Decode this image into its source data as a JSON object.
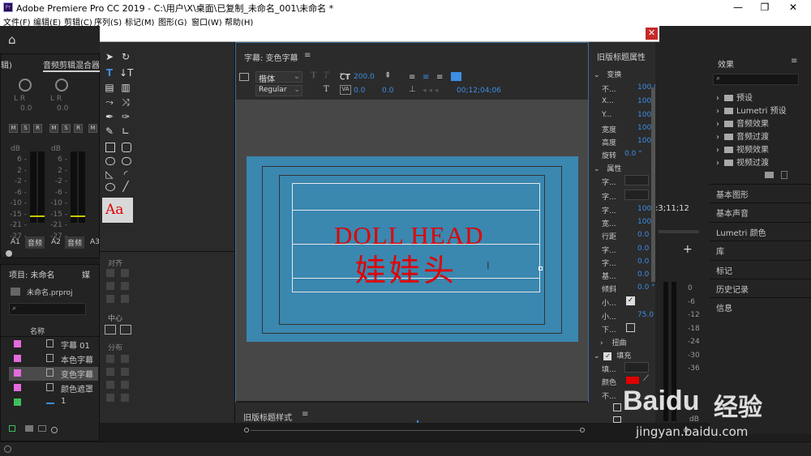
{
  "titlebar": {
    "logo": "Pr",
    "title": "Adobe Premiere Pro CC 2019 - C:\\用户\\X\\桌面\\已复制_未命名_001\\未命名 *",
    "minimize": "—",
    "restore": "❐",
    "close": "✕"
  },
  "menu": [
    "文件(F)",
    "编辑(E)",
    "剪辑(C)",
    "序列(S)",
    "标记(M)",
    "图形(G)",
    "窗口(W)",
    "帮助(H)"
  ],
  "audio_mixer": {
    "tab_left": "辑)",
    "tab": "音频剪辑混合器",
    "lr": "L     R",
    "zero": "0.0",
    "msr": [
      "M",
      "S",
      "R"
    ],
    "db": "dB",
    "scale": [
      "6 -",
      "2 -",
      "-2 -",
      "-6 -",
      "-10 -",
      "-15 -",
      "-21 -",
      "-27 -"
    ],
    "channels": [
      {
        "id": "A1",
        "label": "音频"
      },
      {
        "id": "A2",
        "label": "音频"
      },
      {
        "id": "A3",
        "label": ""
      }
    ]
  },
  "project": {
    "tab": "项目: 未命名",
    "tab2": "媒",
    "file": "未命名.prproj",
    "col_name": "名称",
    "items": [
      {
        "name": "字幕 01",
        "color": "#e36bdc"
      },
      {
        "name": "本色字幕",
        "color": "#e36bdc"
      },
      {
        "name": "变色字幕",
        "color": "#e36bdc"
      },
      {
        "name": "颜色遮罩",
        "color": "#e36bdc"
      },
      {
        "name": "1",
        "color": "#3ec05b"
      }
    ]
  },
  "title_tools": {
    "align_label": "对齐",
    "center_label": "中心",
    "distribute_label": "分布",
    "style_sample": "Aa"
  },
  "title_editor": {
    "tab": "字幕: 变色字幕",
    "font": "楷体",
    "style": "Regular",
    "font_size": "200.0",
    "kerning": "0.0",
    "leading": "0.0",
    "timecode": "00;12;04;06",
    "bold_icon": "T",
    "italic_icon": "T",
    "canvas_text_en": "DOLL HEAD",
    "canvas_text_zh": "娃娃头",
    "bottom_tab": "旧版标题样式"
  },
  "title_props": {
    "tab": "旧版标题属性",
    "transform": "变换",
    "rows_transform": [
      {
        "label": "不...",
        "value": "100.0 %"
      },
      {
        "label": "X...",
        "value": "100.0"
      },
      {
        "label": "Y...",
        "value": "100.0"
      },
      {
        "label": "宽度",
        "value": "100.0"
      },
      {
        "label": "高度",
        "value": "100.0"
      },
      {
        "label": "旋转",
        "value": "0.0 °"
      }
    ],
    "properties": "属性",
    "rows_props": [
      {
        "label": "字...",
        "value": ""
      },
      {
        "label": "字...",
        "value": ""
      },
      {
        "label": "字...",
        "value": "100.0"
      },
      {
        "label": "宽...",
        "value": "100.0 %"
      },
      {
        "label": "行距",
        "value": "0.0"
      },
      {
        "label": "字...",
        "value": "0.0"
      },
      {
        "label": "字...",
        "value": "0.0"
      },
      {
        "label": "基...",
        "value": "0.0"
      },
      {
        "label": "倾斜",
        "value": "0.0 °"
      },
      {
        "label": "小...",
        "value": ""
      },
      {
        "label": "小...",
        "value": "75.0 %"
      },
      {
        "label": "下...",
        "value": ""
      }
    ],
    "distort": "扭曲",
    "fill": "填充",
    "fill_type": "填...",
    "color_label": "颜色",
    "not": "不...",
    "fill_color": "#e00000"
  },
  "timeline": {
    "timecode": ":3;11;12",
    "scale": [
      "0",
      "-6",
      "-12",
      "-18",
      "-24",
      "-30",
      "-36"
    ],
    "db": "dB",
    "s": "S"
  },
  "effects": {
    "tab": "效果",
    "items": [
      "预设",
      "Lumetri 预设",
      "音频效果",
      "音频过渡",
      "视频效果",
      "视频过渡"
    ],
    "panels": [
      "基本图形",
      "基本声音",
      "Lumetri 颜色",
      "库",
      "标记",
      "历史记录",
      "信息"
    ]
  },
  "watermark": {
    "brand": "Bai",
    "paw": "du",
    "cn": "经验",
    "url": "jingyan.baidu.com"
  }
}
